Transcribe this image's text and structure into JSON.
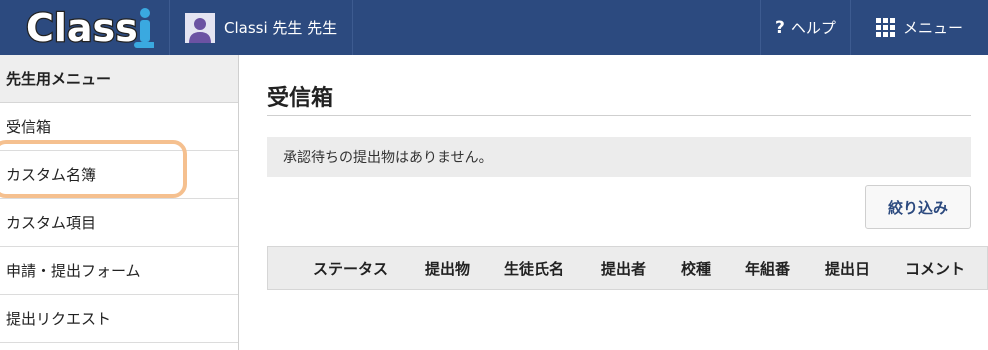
{
  "header": {
    "logo_text": "Classi",
    "user_name": "Classi 先生 先生",
    "help_label": "ヘルプ",
    "menu_label": "メニュー"
  },
  "sidebar": {
    "heading": "先生用メニュー",
    "items": [
      {
        "label": "受信箱"
      },
      {
        "label": "カスタム名簿"
      },
      {
        "label": "カスタム項目"
      },
      {
        "label": "申請・提出フォーム"
      },
      {
        "label": "提出リクエスト"
      }
    ]
  },
  "main": {
    "title": "受信箱",
    "notice": "承認待ちの提出物はありません。",
    "filter_button": "絞り込み",
    "columns": [
      "ステータス",
      "提出物",
      "生徒氏名",
      "提出者",
      "校種",
      "年組番",
      "提出日",
      "コメント"
    ]
  },
  "colors": {
    "header_bg": "#2c4a7f",
    "highlight": "#f5c08f",
    "logo_accent": "#3aa9e0"
  }
}
